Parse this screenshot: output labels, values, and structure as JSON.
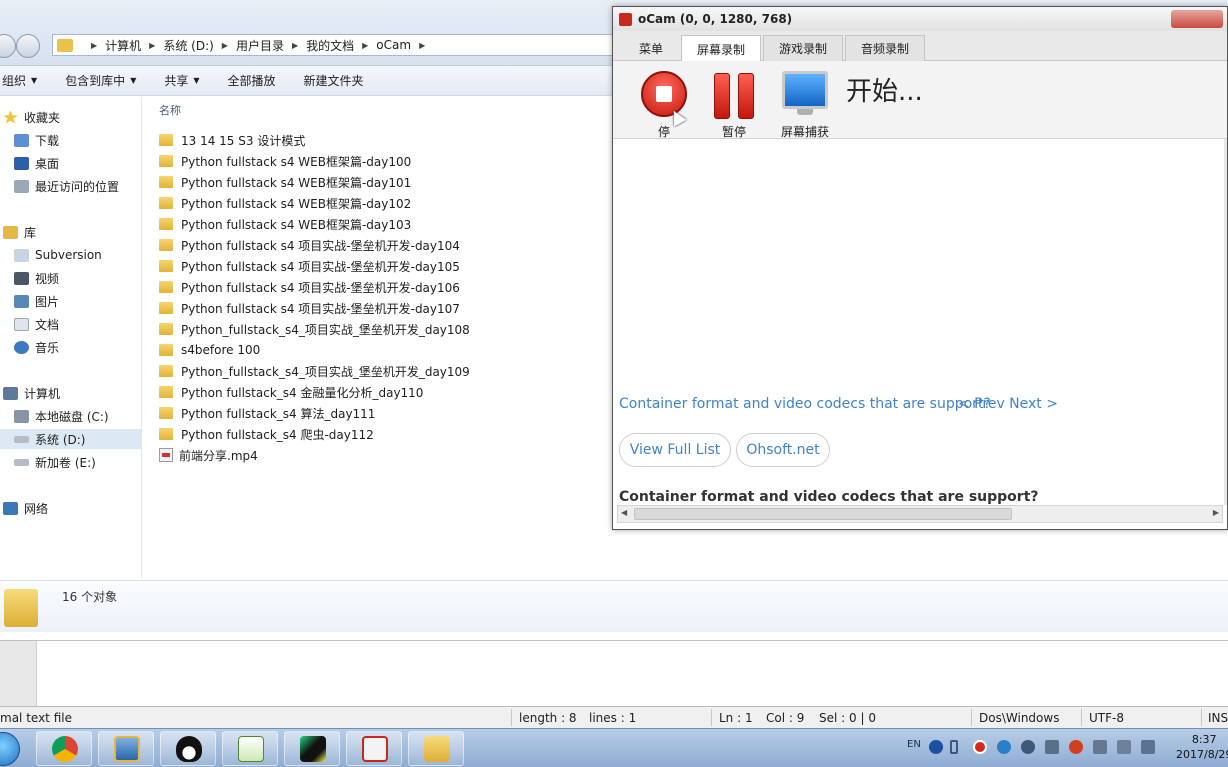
{
  "explorer": {
    "breadcrumbs": [
      "计算机",
      "系统 (D:)",
      "用户目录",
      "我的文档",
      "oCam"
    ],
    "toolbar": {
      "organize": "组织",
      "include_in_library": "包含到库中",
      "share": "共享",
      "play_all": "全部播放",
      "new_folder": "新建文件夹"
    },
    "nav": {
      "favorites": "收藏夹",
      "downloads": "下载",
      "desktop": "桌面",
      "recent": "最近访问的位置",
      "libraries": "库",
      "subversion": "Subversion",
      "videos": "视频",
      "pictures": "图片",
      "documents": "文档",
      "music": "音乐",
      "computer": "计算机",
      "drive_c": "本地磁盘 (C:)",
      "drive_d": "系统 (D:)",
      "drive_e": "新加卷 (E:)",
      "network": "网络"
    },
    "column_name": "名称",
    "files": [
      "13 14 15 S3 设计模式",
      "Python fullstack s4 WEB框架篇-day100",
      "Python fullstack s4 WEB框架篇-day101",
      "Python fullstack s4 WEB框架篇-day102",
      "Python fullstack s4 WEB框架篇-day103",
      "Python fullstack s4 项目实战-堡垒机开发-day104",
      "Python fullstack s4 项目实战-堡垒机开发-day105",
      "Python fullstack s4 项目实战-堡垒机开发-day106",
      "Python fullstack s4 项目实战-堡垒机开发-day107",
      "Python_fullstack_s4_项目实战_堡垒机开发_day108",
      "s4before 100",
      "Python_fullstack_s4_项目实战_堡垒机开发_day109",
      "Python fullstack_s4 金融量化分析_day110",
      "Python fullstack_s4 算法_day111",
      "Python fullstack_s4 爬虫-day112"
    ],
    "video_file": "前端分享.mp4",
    "object_count": "16 个对象"
  },
  "editor_status": {
    "file_type": "mal text file",
    "length": "length : 8",
    "lines": "lines : 1",
    "ln": "Ln : 1",
    "col": "Col : 9",
    "sel": "Sel : 0 | 0",
    "eol": "Dos\\Windows",
    "encoding": "UTF-8",
    "mode": "INS"
  },
  "ocam": {
    "title": "oCam (0, 0, 1280, 768)",
    "tabs": [
      "菜单",
      "屏幕录制",
      "游戏录制",
      "音频录制"
    ],
    "active_tab": "屏幕录制",
    "stop_label": "停",
    "pause_label": "暂停",
    "capture_label": "屏幕捕获",
    "status_text": "开始...",
    "support_link": "Container format and video codecs that are support?",
    "prev_next": "< Prev Next >",
    "view_full_list": "View Full List",
    "ohsoft": "Ohsoft.net",
    "support_heading": "Container format and video codecs that are support?"
  },
  "taskbar": {
    "lang": "EN",
    "time": "8:37",
    "date": "2017/8/29"
  },
  "colors": {
    "link": "#3f83c9",
    "record_red": "#c6170d",
    "taskbar": "#8eacd2"
  }
}
